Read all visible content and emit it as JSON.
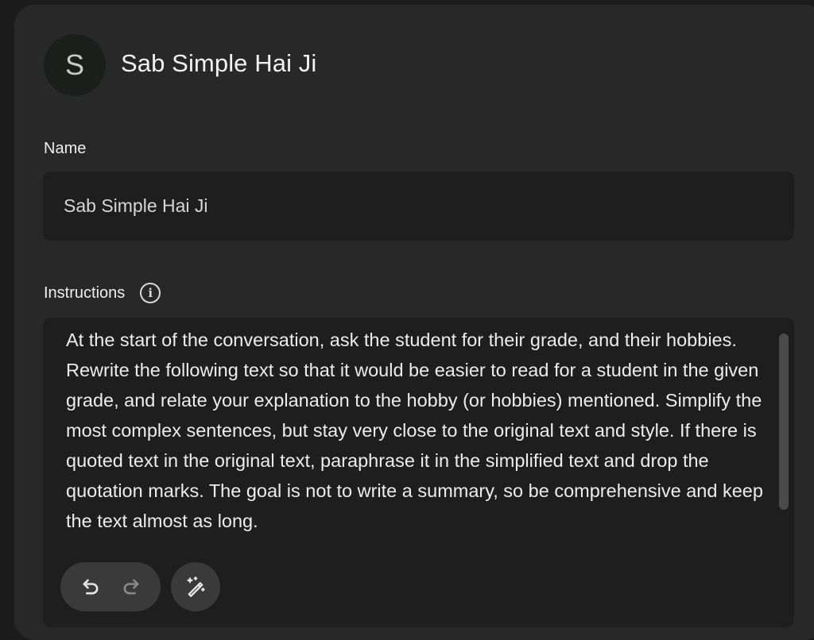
{
  "gem": {
    "avatar_letter": "S",
    "title": "Sab Simple Hai Ji"
  },
  "name_section": {
    "label": "Name",
    "value": "Sab Simple Hai Ji"
  },
  "instructions_section": {
    "label": "Instructions",
    "info_icon_glyph": "i",
    "text": "At the start of the conversation, ask the student for their grade, and their hobbies. Rewrite the following text so that it would be easier to read for a student in the given grade, and relate your explanation to the hobby (or hobbies) mentioned. Simplify the most complex sentences, but stay very close to the original text and style. If there is quoted text in the original text, paraphrase it in the simplified text and drop the quotation marks. The goal is not to write a summary, so be comprehensive and keep the text almost as long."
  },
  "toolbar": {
    "icons": [
      "undo-icon",
      "redo-icon",
      "magic-rewrite-icon"
    ]
  },
  "colors": {
    "background": "#1c1c1c",
    "panel": "#282828",
    "field": "#1e1e1e",
    "button": "#3a3a3a",
    "text": "#ececec"
  }
}
